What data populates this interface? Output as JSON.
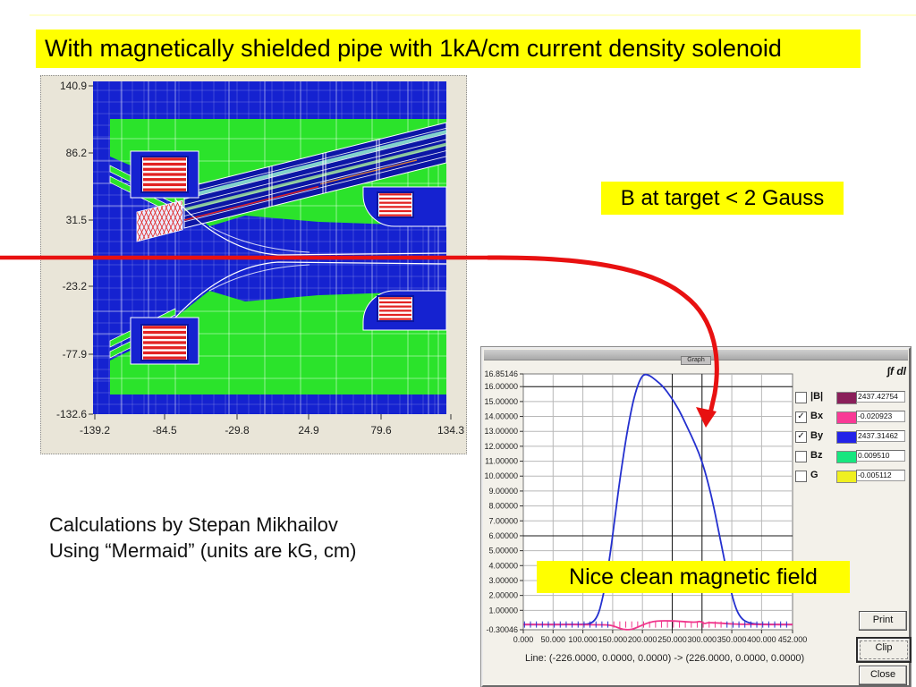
{
  "title": {
    "text": "With magnetically shielded pipe with 1kA/cm current density solenoid"
  },
  "annotations": {
    "b_at_target": "B at target < 2 Gauss",
    "nice_clean": "Nice clean magnetic field",
    "credit_line1": "Calculations by Stepan Mikhailov",
    "credit_line2": "Using “Mermaid” (units are kG, cm)"
  },
  "colors": {
    "highlight_yellow": "#ffff00",
    "arrow_red": "#e81111",
    "magnet_blue": "#1522d0",
    "iron_green": "#2be32b",
    "coil_red": "#e22222",
    "curve_blue": "#2430cf",
    "curve_pink": "#f0368c"
  },
  "magnet_plot": {
    "y_ticks": [
      "140.9",
      "86.2",
      "31.5",
      "-23.2",
      "-77.9",
      "-132.6"
    ],
    "x_ticks": [
      "-139.2",
      "-84.5",
      "-29.8",
      "24.9",
      "79.6",
      "134.3"
    ]
  },
  "graph_window": {
    "title": "Graph",
    "status": "Line: (-226.0000, 0.0000, 0.0000) -> (226.0000, 0.0000, 0.0000)",
    "buttons": [
      "Print",
      "Clip",
      "Close"
    ],
    "legend": {
      "header": "∫f dl",
      "rows": [
        {
          "label": "|B|",
          "checked": false,
          "color": "#8a1f5a",
          "value": "2437.42754"
        },
        {
          "label": "Bx",
          "checked": true,
          "color": "#f93a96",
          "value": "-0.020923"
        },
        {
          "label": "By",
          "checked": true,
          "color": "#2323e8",
          "value": "2437.31462"
        },
        {
          "label": "Bz",
          "checked": false,
          "color": "#17e67f",
          "value": "0.009510"
        },
        {
          "label": "G",
          "checked": false,
          "color": "#f0f020",
          "value": "-0.005112"
        }
      ]
    },
    "chart_data": {
      "type": "line",
      "xlim": [
        0,
        452
      ],
      "ylim": [
        -0.30046,
        16.85146
      ],
      "x_tick_labels": [
        "0.000",
        "50.000",
        "100.000",
        "150.000",
        "200.000",
        "250.000",
        "300.000",
        "350.000",
        "400.000",
        "452.000"
      ],
      "x_tick_values": [
        0,
        50,
        100,
        150,
        200,
        250,
        300,
        350,
        400,
        452
      ],
      "y_tick_labels": [
        "16.85146",
        "16.00000",
        "15.00000",
        "14.00000",
        "13.00000",
        "12.00000",
        "11.00000",
        "10.00000",
        "9.00000",
        "8.00000",
        "7.00000",
        "6.00000",
        "5.00000",
        "4.00000",
        "3.00000",
        "2.00000",
        "1.00000",
        "-0.30046"
      ],
      "y_tick_values": [
        16.85146,
        16,
        15,
        14,
        13,
        12,
        11,
        10,
        9,
        8,
        7,
        6,
        5,
        4,
        3,
        2,
        1,
        -0.30046
      ],
      "dark_gridlines": {
        "x": [
          250,
          300
        ],
        "y": [
          16,
          6
        ]
      },
      "series": [
        {
          "name": "By",
          "color": "#2430cf",
          "points": [
            [
              0,
              0.05
            ],
            [
              100,
              0.05
            ],
            [
              115,
              0.12
            ],
            [
              125,
              0.6
            ],
            [
              132,
              1.6
            ],
            [
              140,
              3.2
            ],
            [
              148,
              5.4
            ],
            [
              156,
              7.9
            ],
            [
              164,
              10.3
            ],
            [
              172,
              12.4
            ],
            [
              180,
              14.2
            ],
            [
              188,
              15.6
            ],
            [
              196,
              16.5
            ],
            [
              203,
              16.85
            ],
            [
              212,
              16.75
            ],
            [
              222,
              16.45
            ],
            [
              235,
              16.0
            ],
            [
              248,
              15.3
            ],
            [
              262,
              14.4
            ],
            [
              275,
              13.3
            ],
            [
              288,
              12.2
            ],
            [
              300,
              11.0
            ],
            [
              310,
              9.6
            ],
            [
              320,
              7.9
            ],
            [
              330,
              5.9
            ],
            [
              340,
              3.9
            ],
            [
              349,
              2.2
            ],
            [
              357,
              1.1
            ],
            [
              365,
              0.5
            ],
            [
              375,
              0.2
            ],
            [
              390,
              0.08
            ],
            [
              420,
              0.05
            ],
            [
              452,
              0.05
            ]
          ]
        },
        {
          "name": "Bx",
          "color": "#f0368c",
          "points": [
            [
              0,
              0.05
            ],
            [
              135,
              0.05
            ],
            [
              148,
              0.0
            ],
            [
              158,
              -0.15
            ],
            [
              168,
              -0.28
            ],
            [
              178,
              -0.3
            ],
            [
              188,
              -0.2
            ],
            [
              198,
              -0.02
            ],
            [
              208,
              0.15
            ],
            [
              218,
              0.25
            ],
            [
              230,
              0.3
            ],
            [
              245,
              0.3
            ],
            [
              260,
              0.27
            ],
            [
              275,
              0.23
            ],
            [
              290,
              0.2
            ],
            [
              297,
              0.28
            ],
            [
              303,
              0.1
            ],
            [
              310,
              0.18
            ],
            [
              325,
              0.16
            ],
            [
              345,
              0.1
            ],
            [
              365,
              0.07
            ],
            [
              400,
              0.05
            ],
            [
              452,
              0.05
            ]
          ]
        }
      ]
    }
  }
}
